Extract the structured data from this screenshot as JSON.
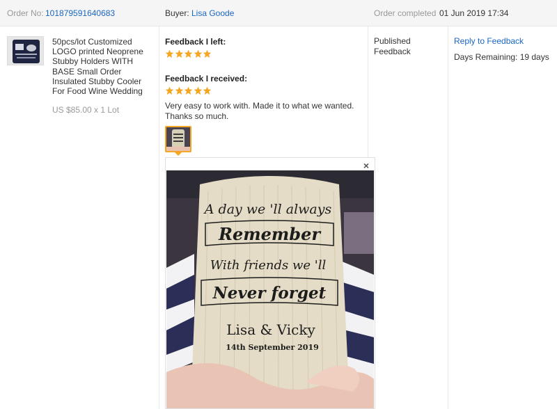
{
  "order": {
    "number_label": "Order No:",
    "number": "101879591640683",
    "buyer_label": "Buyer:",
    "buyer": "Lisa Goode",
    "status_label": "Order completed",
    "completed_at": "01 Jun 2019 17:34"
  },
  "product": {
    "title": "50pcs/lot Customized LOGO printed Neoprene Stubby Holders WITH BASE Small Order Insulated Stubby Cooler For Food Wine Wedding",
    "price": "US $85.00 x 1 Lot"
  },
  "feedback": {
    "left_heading": "Feedback I left:",
    "left_rating": 5,
    "received_heading": "Feedback I received:",
    "received_rating": 5,
    "received_comment": "Very easy to work with. Made it to what we wanted. Thanks so much.",
    "close_symbol": "×",
    "photo_text": {
      "line1": "A day we 'll always",
      "line2": "Remember",
      "line3": "With friends we 'll",
      "line4": "Never forget",
      "names": "Lisa & Vicky",
      "date": "14th September 2019"
    }
  },
  "status": {
    "text": "Published Feedback"
  },
  "actions": {
    "reply_label": "Reply to Feedback",
    "days_remaining": "Days Remaining: 19 days"
  },
  "colors": {
    "link": "#1a66c2",
    "star": "#f5a623",
    "header_bg": "#f5f5f5"
  }
}
